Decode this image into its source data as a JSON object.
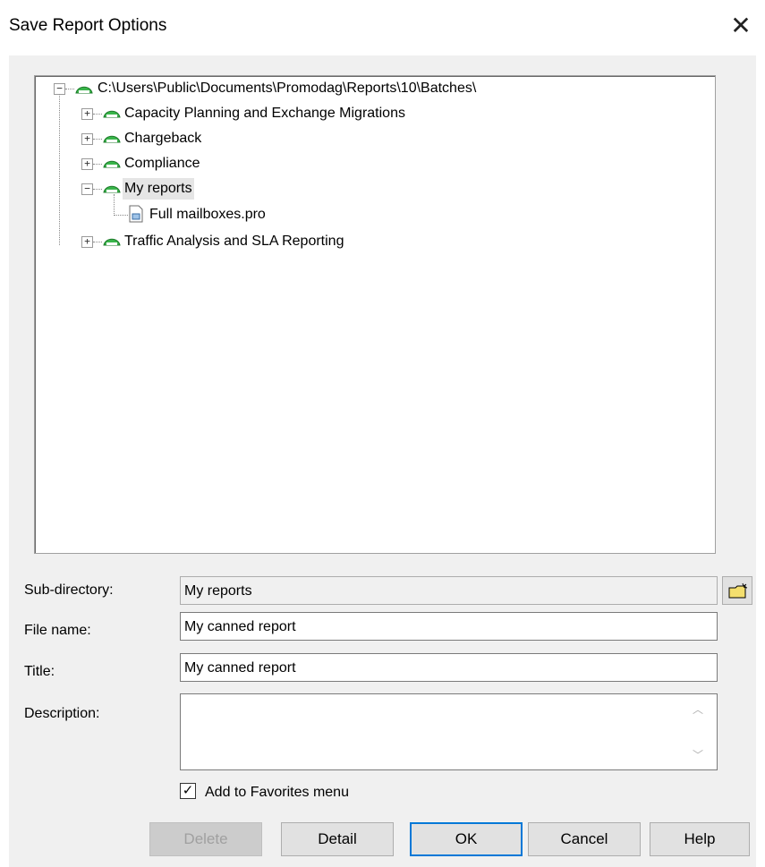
{
  "window": {
    "title": "Save Report Options"
  },
  "tree": {
    "root": "C:\\Users\\Public\\Documents\\Promodag\\Reports\\10\\Batches\\",
    "items": [
      {
        "label": "Capacity Planning and Exchange Migrations",
        "expander": "+"
      },
      {
        "label": "Chargeback",
        "expander": "+"
      },
      {
        "label": "Compliance",
        "expander": "+"
      },
      {
        "label": "My reports",
        "expander": "−"
      },
      {
        "label": "Full mailboxes.pro",
        "expander": ""
      },
      {
        "label": "Traffic Analysis and SLA Reporting",
        "expander": "+"
      }
    ]
  },
  "form": {
    "subdir_label": "Sub-directory:",
    "subdir_value": "My reports",
    "filename_label": "File name:",
    "filename_value": "My canned report",
    "title_label": "Title:",
    "title_value": "My canned report",
    "description_label": "Description:",
    "description_value": "",
    "favorites_label": "Add to Favorites menu",
    "favorites_checked": true
  },
  "buttons": {
    "delete": "Delete",
    "detail": "Detail",
    "ok": "OK",
    "cancel": "Cancel",
    "help": "Help"
  }
}
